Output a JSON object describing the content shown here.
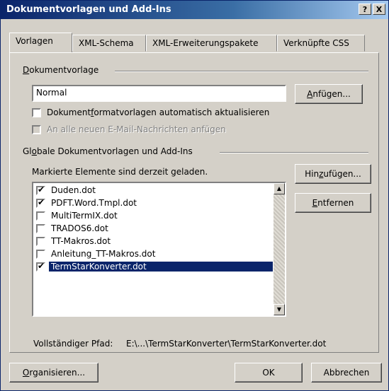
{
  "window": {
    "title": "Dokumentvorlagen und Add-Ins",
    "help_button": "?",
    "close_button": "X"
  },
  "tabs": [
    {
      "label": "Vorlagen",
      "active": true
    },
    {
      "label": "XML-Schema",
      "active": false
    },
    {
      "label": "XML-Erweiterungspakete",
      "active": false
    },
    {
      "label": "Verknüpfte CSS",
      "active": false
    }
  ],
  "document_template": {
    "group_label_access": "D",
    "group_label_rest": "okumentvorlage",
    "value": "Normal",
    "attach_button_access": "A",
    "attach_button_rest": "nfügen...",
    "auto_update_label_pre": "Dokument",
    "auto_update_label_access": "f",
    "auto_update_label_post": "ormatvorlagen automatisch aktualisieren",
    "auto_update_checked": false,
    "email_label": "An alle neuen E-Mail-Nachrichten anfügen",
    "email_enabled": false
  },
  "global_templates": {
    "group_label_pre": "Gl",
    "group_label_access": "o",
    "group_label_post": "bale Dokumentvorlagen und Add-Ins",
    "status_text": "Markierte Elemente sind derzeit geladen.",
    "items": [
      {
        "name": "Duden.dot",
        "checked": true
      },
      {
        "name": "PDFT.Word.Tmpl.dot",
        "checked": true
      },
      {
        "name": "MultiTermIX.dot",
        "checked": false
      },
      {
        "name": "TRADOS6.dot",
        "checked": false
      },
      {
        "name": "TT-Makros.dot",
        "checked": false
      },
      {
        "name": "Anleitung_TT-Makros.dot",
        "checked": false
      },
      {
        "name": "TermStarKonverter.dot",
        "checked": true,
        "selected": true
      }
    ],
    "add_button_pre": "Hin",
    "add_button_access": "z",
    "add_button_post": "ufügen...",
    "remove_button_access": "E",
    "remove_button_rest": "ntfernen"
  },
  "full_path": {
    "label": "Vollständiger Pfad:",
    "value": "E:\\...\\TermStarKonverter\\TermStarKonverter.dot"
  },
  "footer": {
    "organize_button_access": "O",
    "organize_button_rest": "rganisieren...",
    "ok_button": "OK",
    "cancel_button": "Abbrechen"
  },
  "colors": {
    "titlebar_start": "#0a246a",
    "selection": "#0a246a",
    "face": "#d4d0c8"
  }
}
